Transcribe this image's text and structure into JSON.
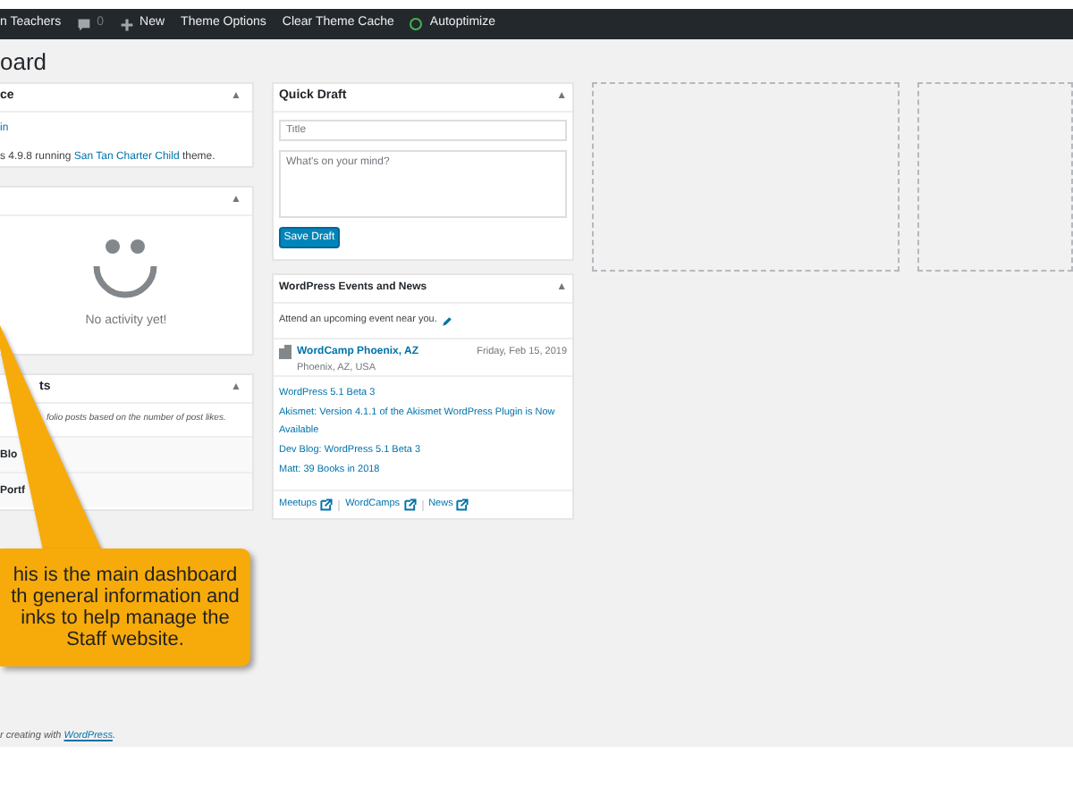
{
  "admin_bar": {
    "site": "n Teachers",
    "comments": "0",
    "new": "New",
    "items": [
      "Theme Options",
      "Clear Theme Cache"
    ],
    "status": {
      "label": "Autoptimize",
      "color": "#46b450"
    }
  },
  "page_title": "oard",
  "left_panels": [
    {
      "title": "ce",
      "toggle": "▲",
      "link": "in",
      "text": "s 4.9.8 running **San Tan Charter Child** theme."
    },
    {
      "toggle": "▲",
      "empty": "No activity yet!"
    },
    {
      "title": "ts",
      "toggle": "▲",
      "note": "folio posts based on the number of post likes.",
      "rows": [
        "Blo",
        "Portf"
      ]
    }
  ],
  "quick_draft": {
    "title": "Quick Draft",
    "toggle": "▲",
    "title_placeholder": "Title",
    "content_placeholder": "What's on your mind?",
    "button": "Save Draft"
  },
  "events": {
    "title": "WordPress Events and News",
    "toggle": "▲",
    "intro": "Attend an upcoming event near you.",
    "event": {
      "name": "WordCamp Phoenix, AZ",
      "place": "Phoenix, AZ, USA",
      "date": "Friday, Feb 15, 2019"
    },
    "news": [
      "WordPress 5.1 Beta 3",
      "Akismet: Version 4.1.1 of the Akismet WordPress Plugin is Now Available",
      "Dev Blog: WordPress 5.1 Beta 3",
      "Matt: 39 Books in 2018"
    ],
    "links": [
      "Meetups",
      "WordCamps",
      "News"
    ]
  },
  "callout": "his is the main dashboard\nth general information and\ninks to help manage the\nStaff website.",
  "footer": {
    "text": "r creating with ",
    "link": "WordPress",
    "end": "."
  }
}
